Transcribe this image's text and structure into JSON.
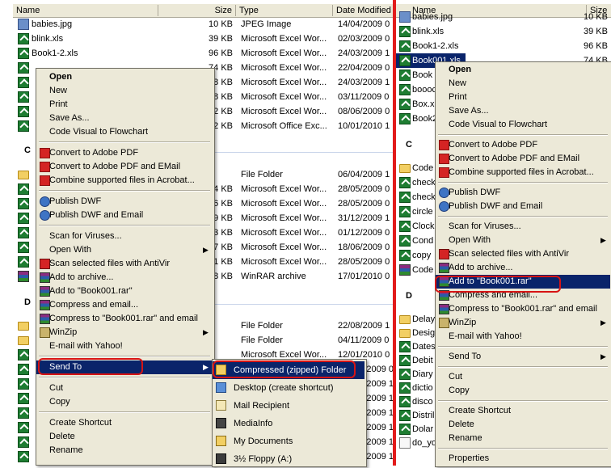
{
  "left": {
    "columns": {
      "name": "Name",
      "size": "Size",
      "type": "Type",
      "date": "Date Modified"
    },
    "files": [
      {
        "name": "babies.jpg",
        "size": "10 KB",
        "type": "JPEG Image",
        "date": "14/04/2009 0",
        "icon": "jpg"
      },
      {
        "name": "blink.xls",
        "size": "39 KB",
        "type": "Microsoft Excel Wor...",
        "date": "02/03/2009 0",
        "icon": "xls"
      },
      {
        "name": "Book1-2.xls",
        "size": "96 KB",
        "type": "Microsoft Excel Wor...",
        "date": "24/03/2009 1",
        "icon": "xls"
      },
      {
        "name": "",
        "size": "74 KB",
        "type": "Microsoft Excel Wor...",
        "date": "22/04/2009 0",
        "icon": "xls"
      },
      {
        "name": "",
        "size": "8 KB",
        "type": "Microsoft Excel Wor...",
        "date": "24/03/2009 1",
        "icon": "xls"
      },
      {
        "name": "",
        "size": "8 KB",
        "type": "Microsoft Excel Wor...",
        "date": "03/11/2009 0",
        "icon": "xls"
      },
      {
        "name": "",
        "size": "2 KB",
        "type": "Microsoft Excel Wor...",
        "date": "08/06/2009 0",
        "icon": "xls"
      },
      {
        "name": "",
        "size": "2 KB",
        "type": "Microsoft Office Exc...",
        "date": "10/01/2010 1",
        "icon": "xls"
      }
    ],
    "group_c": "C",
    "files_c": [
      {
        "size": "",
        "type": "File Folder",
        "date": "06/04/2009 1",
        "icon": "folder"
      },
      {
        "size": "4 KB",
        "type": "Microsoft Excel Wor...",
        "date": "28/05/2009 0",
        "icon": "xls"
      },
      {
        "size": "6 KB",
        "type": "Microsoft Excel Wor...",
        "date": "28/05/2009 0",
        "icon": "xls"
      },
      {
        "size": "9 KB",
        "type": "Microsoft Excel Wor...",
        "date": "31/12/2009 1",
        "icon": "xls"
      },
      {
        "size": "3 KB",
        "type": "Microsoft Excel Wor...",
        "date": "01/12/2009 0",
        "icon": "xls"
      },
      {
        "size": "7 KB",
        "type": "Microsoft Excel Wor...",
        "date": "18/06/2009 0",
        "icon": "xls"
      },
      {
        "size": "1 KB",
        "type": "Microsoft Excel Wor...",
        "date": "28/05/2009 0",
        "icon": "xls"
      },
      {
        "size": "8 KB",
        "type": "WinRAR archive",
        "date": "17/01/2010 0",
        "icon": "rar"
      }
    ],
    "group_d": "D",
    "files_d": [
      {
        "size": "",
        "type": "File Folder",
        "date": "22/08/2009 1",
        "icon": "folder"
      },
      {
        "size": "",
        "type": "File Folder",
        "date": "04/11/2009 0",
        "icon": "folder"
      },
      {
        "size": "",
        "type": "Microsoft Excel Wor...",
        "date": "12/01/2010 0",
        "icon": "xls"
      },
      {
        "size": "",
        "type": "",
        "date": "2009 0",
        "icon": "xls"
      },
      {
        "size": "",
        "type": "",
        "date": "2009 1",
        "icon": "xls"
      },
      {
        "size": "",
        "type": "",
        "date": "2009 1",
        "icon": "xls"
      },
      {
        "size": "",
        "type": "",
        "date": "2009 1",
        "icon": "xls"
      },
      {
        "size": "",
        "type": "",
        "date": "2009 1",
        "icon": "xls"
      },
      {
        "size": "",
        "type": "",
        "date": "2009 1",
        "icon": "xls"
      },
      {
        "size": "",
        "type": "",
        "date": "2009 1",
        "icon": "xls"
      },
      {
        "size": "",
        "type": "",
        "date": "2008 0",
        "icon": "xls"
      }
    ],
    "context_menu": [
      {
        "label": "Open",
        "bold": true
      },
      {
        "label": "New"
      },
      {
        "label": "Print"
      },
      {
        "label": "Save As..."
      },
      {
        "label": "Code Visual to Flowchart"
      },
      {
        "sep": true
      },
      {
        "label": "Convert to Adobe PDF",
        "icon": "pdf"
      },
      {
        "label": "Convert to Adobe PDF and EMail",
        "icon": "pdf"
      },
      {
        "label": "Combine supported files in Acrobat...",
        "icon": "pdf"
      },
      {
        "sep": true
      },
      {
        "label": "Publish DWF",
        "icon": "dwf"
      },
      {
        "label": "Publish DWF and Email",
        "icon": "dwf"
      },
      {
        "sep": true
      },
      {
        "label": "Scan for Viruses..."
      },
      {
        "label": "Open With",
        "arrow": true
      },
      {
        "label": "Scan selected files with AntiVir",
        "icon": "av"
      },
      {
        "label": "Add to archive...",
        "icon": "rar"
      },
      {
        "label": "Add to \"Book001.rar\"",
        "icon": "rar"
      },
      {
        "label": "Compress and email...",
        "icon": "rar"
      },
      {
        "label": "Compress to \"Book001.rar\" and email",
        "icon": "rar"
      },
      {
        "label": "WinZip",
        "icon": "zip",
        "arrow": true
      },
      {
        "label": "E-mail with Yahoo!"
      },
      {
        "sep": true
      },
      {
        "label": "Send To",
        "arrow": true,
        "highlight": true
      },
      {
        "sep": true
      },
      {
        "label": "Cut"
      },
      {
        "label": "Copy"
      },
      {
        "sep": true
      },
      {
        "label": "Create Shortcut"
      },
      {
        "label": "Delete"
      },
      {
        "label": "Rename"
      }
    ],
    "send_to_menu": [
      {
        "label": "Compressed (zipped) Folder",
        "icon": "zipf",
        "highlight": true
      },
      {
        "label": "Desktop (create shortcut)",
        "icon": "desk"
      },
      {
        "label": "Mail Recipient",
        "icon": "mail"
      },
      {
        "label": "MediaInfo",
        "icon": "media"
      },
      {
        "label": "My Documents",
        "icon": "docs"
      },
      {
        "label": "3½ Floppy (A:)",
        "icon": "flop"
      }
    ]
  },
  "right": {
    "columns": {
      "name": "Name",
      "size": "Size"
    },
    "files": [
      {
        "name": "babies.jpg",
        "size": "10 KB",
        "icon": "jpg"
      },
      {
        "name": "blink.xls",
        "size": "39 KB",
        "icon": "xls"
      },
      {
        "name": "Book1-2.xls",
        "size": "96 KB",
        "icon": "xls"
      },
      {
        "name": "Book001.xls",
        "size": "74 KB",
        "icon": "xls",
        "selected": true
      },
      {
        "name": "Book",
        "size": "",
        "icon": "xls"
      },
      {
        "name": "boooc",
        "size": "",
        "icon": "xls"
      },
      {
        "name": "Box.x",
        "size": "",
        "icon": "xls"
      },
      {
        "name": "Book2",
        "size": "",
        "icon": "xls"
      }
    ],
    "group_c": "C",
    "files_c": [
      {
        "name": "Code",
        "icon": "folder"
      },
      {
        "name": "check",
        "icon": "xls"
      },
      {
        "name": "check",
        "icon": "xls"
      },
      {
        "name": "circle",
        "icon": "xls"
      },
      {
        "name": "Clock",
        "icon": "xls"
      },
      {
        "name": "Cond",
        "icon": "xls"
      },
      {
        "name": "copy",
        "icon": "xls"
      },
      {
        "name": "Code",
        "icon": "rar"
      }
    ],
    "group_d": "D",
    "files_d": [
      {
        "name": "Delay",
        "icon": "folder"
      },
      {
        "name": "Desig",
        "icon": "folder"
      },
      {
        "name": "Dates",
        "icon": "xls"
      },
      {
        "name": "Debit",
        "icon": "xls"
      },
      {
        "name": "Diary",
        "icon": "xls"
      },
      {
        "name": "dictio",
        "icon": "xls"
      },
      {
        "name": "disco",
        "icon": "xls"
      },
      {
        "name": "Distril",
        "icon": "xls"
      },
      {
        "name": "Dolar",
        "icon": "xls"
      },
      {
        "name": "do_yo",
        "icon": "txt"
      }
    ],
    "context_menu": [
      {
        "label": "Open",
        "bold": true
      },
      {
        "label": "New"
      },
      {
        "label": "Print"
      },
      {
        "label": "Save As..."
      },
      {
        "label": "Code Visual to Flowchart"
      },
      {
        "sep": true
      },
      {
        "label": "Convert to Adobe PDF",
        "icon": "pdf"
      },
      {
        "label": "Convert to Adobe PDF and EMail",
        "icon": "pdf"
      },
      {
        "label": "Combine supported files in Acrobat...",
        "icon": "pdf"
      },
      {
        "sep": true
      },
      {
        "label": "Publish DWF",
        "icon": "dwf"
      },
      {
        "label": "Publish DWF and Email",
        "icon": "dwf"
      },
      {
        "sep": true
      },
      {
        "label": "Scan for Viruses..."
      },
      {
        "label": "Open With",
        "arrow": true
      },
      {
        "label": "Scan selected files with AntiVir",
        "icon": "av"
      },
      {
        "label": "Add to archive...",
        "icon": "rar"
      },
      {
        "label": "Add to \"Book001.rar\"",
        "icon": "rar",
        "highlight": true
      },
      {
        "label": "Compress and email...",
        "icon": "rar"
      },
      {
        "label": "Compress to \"Book001.rar\" and email",
        "icon": "rar"
      },
      {
        "label": "WinZip",
        "icon": "zip",
        "arrow": true
      },
      {
        "label": "E-mail with Yahoo!"
      },
      {
        "sep": true
      },
      {
        "label": "Send To",
        "arrow": true
      },
      {
        "sep": true
      },
      {
        "label": "Cut"
      },
      {
        "label": "Copy"
      },
      {
        "sep": true
      },
      {
        "label": "Create Shortcut"
      },
      {
        "label": "Delete"
      },
      {
        "label": "Rename"
      },
      {
        "sep": true
      },
      {
        "label": "Properties"
      }
    ]
  },
  "colors": {
    "highlight": "#0a246a",
    "menu_bg": "#ece9d8",
    "annotation": "#d71414"
  }
}
